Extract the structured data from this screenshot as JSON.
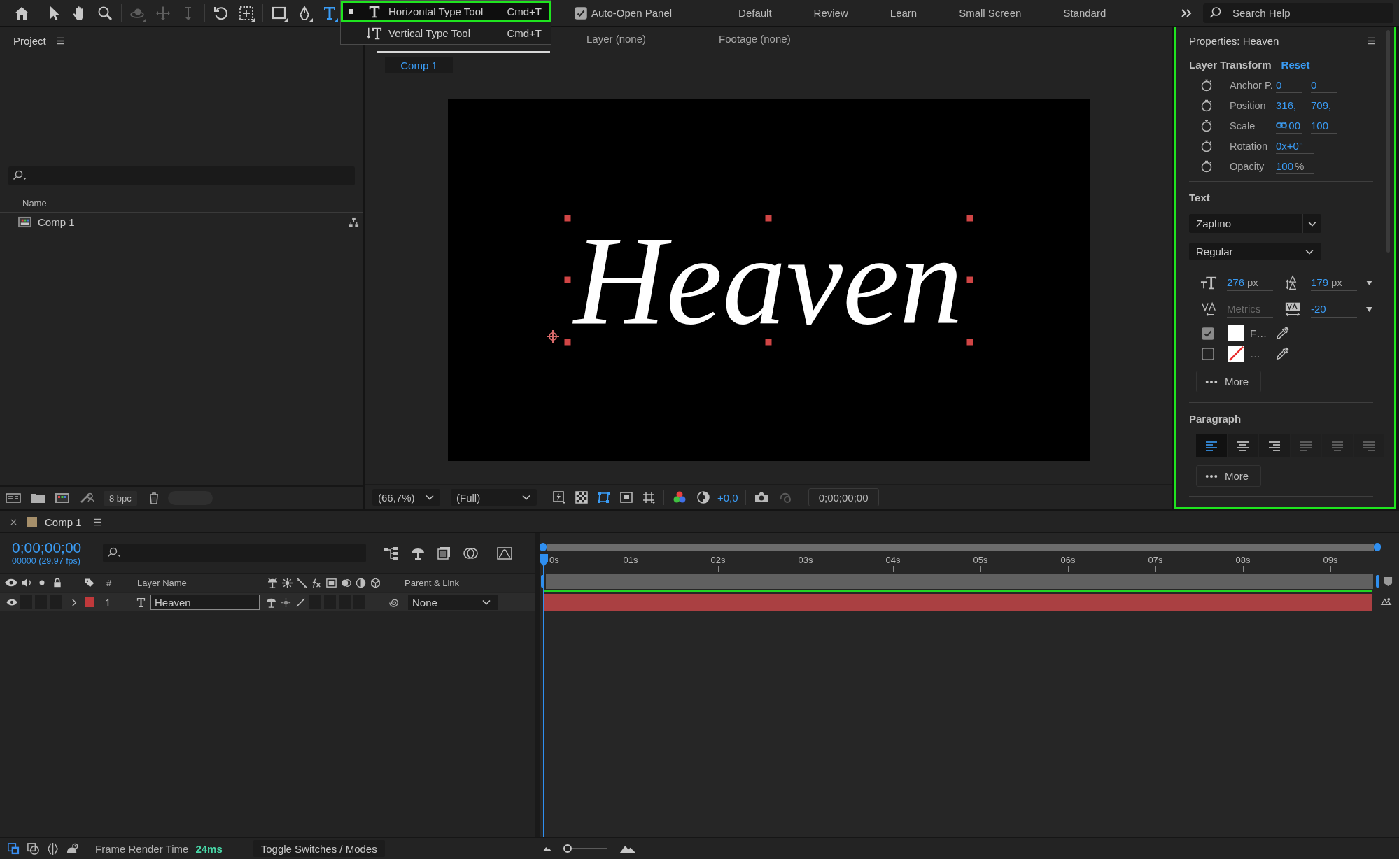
{
  "toolbar": {
    "tool_groups": [
      [
        {
          "kind": "home",
          "selected": false,
          "disabled": false
        }
      ],
      [
        {
          "kind": "selection",
          "selected": false,
          "disabled": false
        },
        {
          "kind": "hand",
          "selected": false,
          "disabled": false
        },
        {
          "kind": "zoom",
          "selected": false,
          "disabled": false
        }
      ],
      [
        {
          "kind": "orbit",
          "selected": false,
          "disabled": true
        },
        {
          "kind": "move",
          "selected": false,
          "disabled": true
        },
        {
          "kind": "dolly",
          "selected": false,
          "disabled": true
        }
      ],
      [
        {
          "kind": "rotate",
          "selected": false,
          "disabled": false
        },
        {
          "kind": "pan-behind",
          "selected": false,
          "disabled": false
        }
      ],
      [
        {
          "kind": "rectangle",
          "selected": false,
          "disabled": false
        },
        {
          "kind": "pen",
          "selected": false,
          "disabled": false
        },
        {
          "kind": "type",
          "selected": true,
          "disabled": false
        }
      ]
    ],
    "type_menu": [
      {
        "kind": "horizontal",
        "label": "Horizontal Type Tool",
        "shortcut": "Cmd+T",
        "selected": true,
        "highlighted": true
      },
      {
        "kind": "vertical",
        "label": "Vertical Type Tool",
        "shortcut": "Cmd+T",
        "selected": false,
        "highlighted": false
      }
    ],
    "auto_open_panel": {
      "label": "Auto-Open Panel",
      "checked": true
    },
    "workspaces": [
      {
        "label": "Default",
        "selected": false
      },
      {
        "label": "Review",
        "selected": false
      },
      {
        "label": "Learn",
        "selected": false
      },
      {
        "label": "Small Screen",
        "selected": false
      },
      {
        "label": "Standard",
        "selected": false
      }
    ],
    "search_help": {
      "placeholder": "Search Help"
    }
  },
  "project_panel": {
    "title": "Project",
    "columns": [
      "Name"
    ],
    "items": [
      {
        "name": "Comp 1",
        "selected": false
      }
    ],
    "bit_depth": "8 bpc"
  },
  "viewer": {
    "tabs": [
      {
        "selected": true
      },
      {
        "label": "Layer (none)",
        "selected": false
      },
      {
        "label": "Footage (none)",
        "selected": false
      }
    ],
    "breadcrumb": [
      {
        "label": "Comp 1",
        "selected": true
      }
    ],
    "canvas_text": "Heaven",
    "zoom": "(66,7%)",
    "resolution": "(Full)",
    "view_toggles": [
      {
        "kind": "fast-previews",
        "on": false
      },
      {
        "kind": "transparency-grid",
        "on": false
      },
      {
        "kind": "mask-path",
        "on": true
      },
      {
        "kind": "region-of-interest",
        "on": false
      },
      {
        "kind": "guides",
        "on": false
      }
    ],
    "exposure": "+0,0",
    "timecode": "0;00;00;00"
  },
  "properties": {
    "title": "Properties: Heaven",
    "highlighted": true,
    "transform": {
      "title": "Layer Transform",
      "reset": "Reset",
      "rows": [
        {
          "label": "Anchor P.",
          "values": [
            "0",
            "0"
          ],
          "linked": false
        },
        {
          "label": "Position",
          "values": [
            "316,",
            "709,"
          ],
          "linked": false
        },
        {
          "label": "Scale",
          "values": [
            "100",
            "100"
          ],
          "linked": true
        },
        {
          "label": "Rotation",
          "values": [
            "0x+0°"
          ],
          "linked": false
        },
        {
          "label": "Opacity",
          "values": [
            "100"
          ],
          "unit": "%",
          "linked": false
        }
      ]
    },
    "text": {
      "title": "Text",
      "font": "Zapfino",
      "style": "Regular",
      "size": "276",
      "size_unit": "px",
      "leading": "179",
      "leading_unit": "px",
      "kerning_placeholder": "Metrics",
      "tracking": "-20",
      "fill": {
        "checked": true,
        "color": "#ffffff",
        "label": "F…"
      },
      "stroke": {
        "checked": false,
        "label": "…"
      },
      "more": "More"
    },
    "paragraph": {
      "title": "Paragraph",
      "alignments": [
        {
          "kind": "left",
          "selected": true,
          "disabled": false
        },
        {
          "kind": "center",
          "selected": false,
          "disabled": false
        },
        {
          "kind": "right",
          "selected": false,
          "disabled": false
        },
        {
          "kind": "justify-left",
          "selected": false,
          "disabled": true
        },
        {
          "kind": "justify-center",
          "selected": false,
          "disabled": true
        },
        {
          "kind": "justify-right",
          "selected": false,
          "disabled": true
        }
      ],
      "more": "More"
    }
  },
  "timeline": {
    "tab_title": "Comp 1",
    "timecode": "0;00;00;00",
    "fps": "00000 (29.97 fps)",
    "number_heading": "#",
    "name_heading": "Layer Name",
    "parent_heading": "Parent & Link",
    "ruler": [
      "0s",
      "01s",
      "02s",
      "03s",
      "04s",
      "05s",
      "06s",
      "07s",
      "08s",
      "09s"
    ],
    "layers": [
      {
        "number": "1",
        "name": "Heaven",
        "color": "#c0393b",
        "visible": true,
        "expanded": false,
        "selected": true,
        "parent": "None"
      }
    ]
  },
  "status_bar": {
    "panes": [
      {
        "kind": "layer-switches",
        "on": true
      },
      {
        "kind": "transfer-controls",
        "on": false
      },
      {
        "kind": "in-out",
        "on": false
      },
      {
        "kind": "render-time",
        "on": false
      }
    ],
    "render_label": "Frame Render Time",
    "render_time": "24ms",
    "toggle": "Toggle Switches / Modes",
    "zoom": {
      "level": 0.0
    }
  }
}
